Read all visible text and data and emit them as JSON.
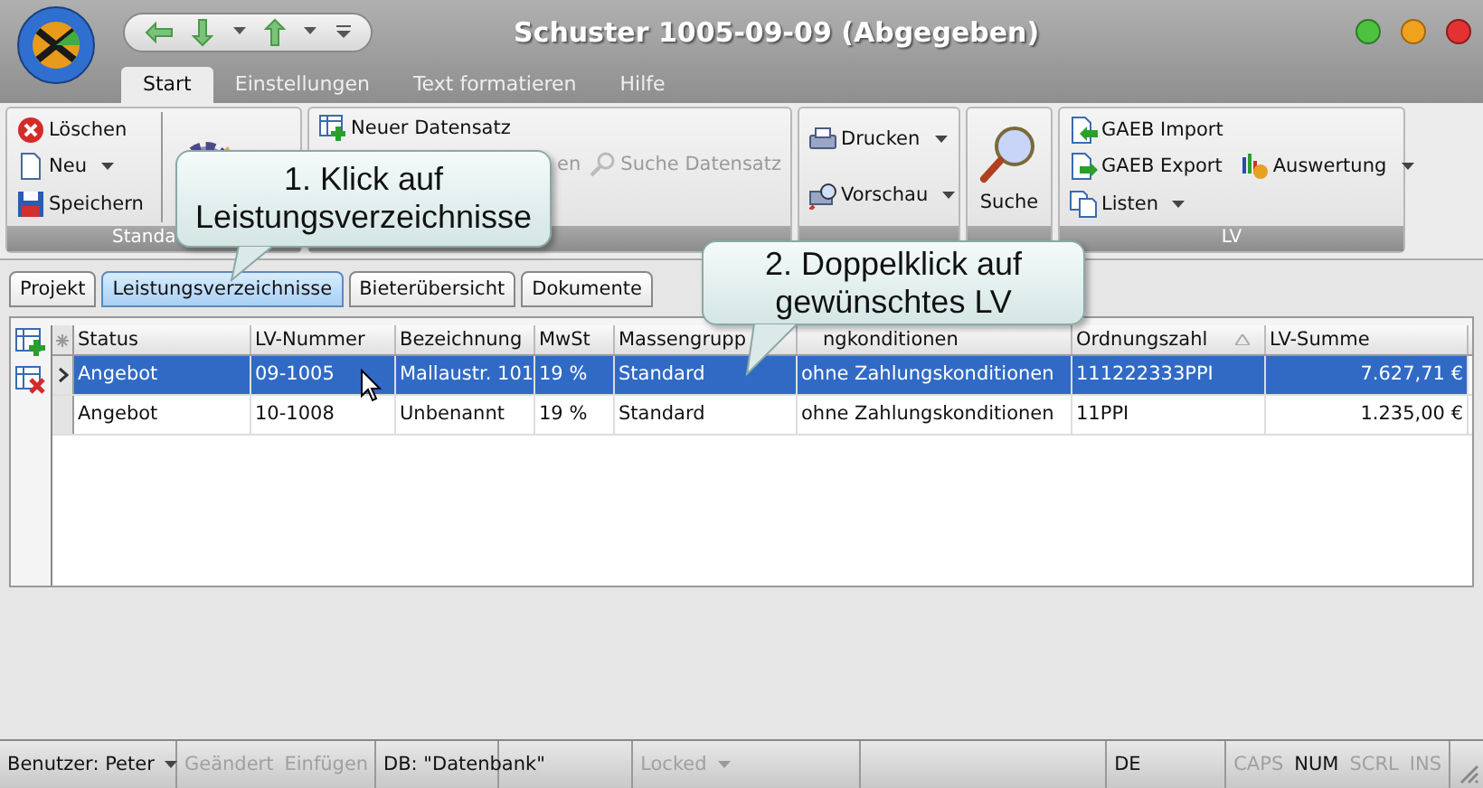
{
  "window": {
    "title": "Schuster 1005-09-09 (Abgegeben)"
  },
  "ribbon_tabs": [
    {
      "label": "Start",
      "selected": true
    },
    {
      "label": "Einstellungen",
      "selected": false
    },
    {
      "label": "Text formatieren",
      "selected": false
    },
    {
      "label": "Hilfe",
      "selected": false
    }
  ],
  "ribbon_groups": [
    {
      "label": "Standa",
      "parts": [
        {
          "kind": "rows",
          "rows": [
            [
              {
                "label": "Löschen",
                "dropdown": false,
                "disabled": false
              }
            ],
            [
              {
                "label": "Neu",
                "dropdown": true,
                "disabled": false
              }
            ],
            [
              {
                "label": "Speichern",
                "dropdown": false,
                "disabled": false
              }
            ]
          ]
        },
        {
          "kind": "large"
        }
      ]
    },
    {
      "parts": [
        {
          "kind": "rows",
          "rows": [
            [
              {
                "label": "Neuer Datensatz",
                "dropdown": false,
                "disabled": false
              }
            ],
            [
              {
                "label": "en",
                "dropdown": false,
                "disabled": true
              },
              {
                "label": "Suche Datensatz",
                "dropdown": false,
                "disabled": true
              }
            ]
          ]
        }
      ]
    },
    {
      "parts": [
        {
          "kind": "rows",
          "rows": [
            [
              {
                "label": "Drucken",
                "dropdown": true,
                "disabled": false
              }
            ],
            [
              {
                "label": "Vorschau",
                "dropdown": true,
                "disabled": false
              }
            ]
          ]
        }
      ]
    },
    {
      "parts": [
        {
          "kind": "large",
          "label": "Suche"
        }
      ]
    },
    {
      "label": "LV",
      "parts": [
        {
          "kind": "rows",
          "rows": [
            [
              {
                "label": "GAEB Import",
                "dropdown": false,
                "disabled": false
              }
            ],
            [
              {
                "label": "GAEB Export",
                "dropdown": false,
                "disabled": false
              },
              {
                "label": "Auswertung",
                "dropdown": true,
                "disabled": false
              }
            ],
            [
              {
                "label": "Listen",
                "dropdown": true,
                "disabled": false
              }
            ]
          ]
        }
      ]
    }
  ],
  "callouts": [
    {
      "text": "1. Klick auf Leistungsverzeichnisse"
    },
    {
      "text": "2. Doppelklick auf gewünschtes LV"
    }
  ],
  "doc_tabs": [
    {
      "label": "Projekt",
      "selected": false
    },
    {
      "label": "Leistungsverzeichnisse",
      "selected": true
    },
    {
      "label": "Bieterübersicht",
      "selected": false
    },
    {
      "label": "Dokumente",
      "selected": false
    }
  ],
  "table": {
    "columns": [
      {
        "label": "Status",
        "sorted": false
      },
      {
        "label": "LV-Nummer",
        "sorted": false
      },
      {
        "label": "Bezeichnung",
        "sorted": false
      },
      {
        "label": "MwSt",
        "sorted": false
      },
      {
        "label": "Massengrupp",
        "sorted": false
      },
      {
        "label": "ngkonditionen",
        "sorted": false
      },
      {
        "label": "Ordnungszahl",
        "sorted": true
      },
      {
        "label": "LV-Summe",
        "sorted": false
      }
    ],
    "rows": [
      {
        "selected": true,
        "cells": [
          "Angebot",
          "09-1005",
          "Mallaustr. 101",
          "19 %",
          "Standard",
          "ohne Zahlungskonditionen",
          "111222333PPI",
          "7.627,71 €"
        ]
      },
      {
        "selected": false,
        "cells": [
          "Angebot",
          "10-1008",
          "Unbenannt",
          "19 %",
          "Standard",
          "ohne Zahlungskonditionen",
          "11PPI",
          "1.235,00 €"
        ]
      }
    ]
  },
  "status_bar": [
    {
      "items": [
        {
          "text": "Benutzer: Peter",
          "disabled": false,
          "dropdown": true
        }
      ]
    },
    {
      "items": [
        {
          "text": "Geändert",
          "disabled": true,
          "dropdown": false
        },
        {
          "text": "Einfügen",
          "disabled": true,
          "dropdown": false
        }
      ]
    },
    {
      "items": [
        {
          "text": "DB: \"Datenbank\"",
          "disabled": false,
          "dropdown": false
        }
      ]
    },
    {
      "items": [
        {
          "text": "Locked",
          "disabled": true,
          "dropdown": true
        }
      ]
    },
    {
      "items": [
        {
          "text": "DE",
          "disabled": false,
          "dropdown": false
        }
      ]
    },
    {
      "items": [
        {
          "text": "CAPS",
          "disabled": true,
          "dropdown": false
        },
        {
          "text": "NUM",
          "disabled": false,
          "dropdown": false
        },
        {
          "text": "SCRL",
          "disabled": true,
          "dropdown": false
        },
        {
          "text": "INS",
          "disabled": true,
          "dropdown": false
        }
      ]
    }
  ]
}
